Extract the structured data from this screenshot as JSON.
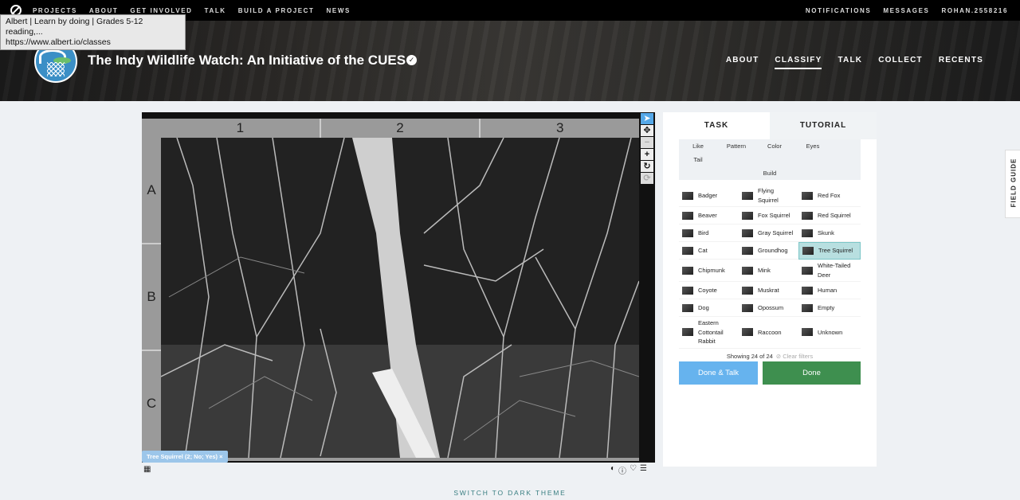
{
  "topnav": {
    "links": [
      "PROJECTS",
      "ABOUT",
      "GET INVOLVED",
      "TALK",
      "BUILD A PROJECT",
      "NEWS"
    ],
    "right": [
      "NOTIFICATIONS",
      "MESSAGES",
      "ROHAN.2558216"
    ]
  },
  "tooltip": {
    "line1": "Albert | Learn by doing | Grades 5-12 reading,...",
    "line2": "https://www.albert.io/classes"
  },
  "project": {
    "title": "The Indy Wildlife Watch: An Initiative of the CUES",
    "verified_icon": "check-icon",
    "nav": [
      "ABOUT",
      "CLASSIFY",
      "TALK",
      "COLLECT",
      "RECENTS"
    ],
    "active_nav": "CLASSIFY"
  },
  "viewer": {
    "cols": [
      "1",
      "2",
      "3"
    ],
    "rows": [
      "A",
      "B",
      "C"
    ],
    "tools": [
      "pointer-icon",
      "move-icon",
      "zoom-out-icon",
      "zoom-in-icon",
      "rotate-icon",
      "reset-icon"
    ],
    "tag": "Tree Squirrel (2; No; Yes)  ×"
  },
  "panel": {
    "tabs": {
      "task": "TASK",
      "tutorial": "TUTORIAL"
    },
    "filters": [
      "Like",
      "Pattern",
      "Color",
      "Eyes",
      "Tail",
      "Build"
    ],
    "species": [
      {
        "name": "Badger"
      },
      {
        "name": "Flying Squirrel"
      },
      {
        "name": "Red Fox"
      },
      {
        "name": "Beaver"
      },
      {
        "name": "Fox Squirrel"
      },
      {
        "name": "Red Squirrel"
      },
      {
        "name": "Bird"
      },
      {
        "name": "Gray Squirrel"
      },
      {
        "name": "Skunk"
      },
      {
        "name": "Cat"
      },
      {
        "name": "Groundhog"
      },
      {
        "name": "Tree Squirrel",
        "selected": true
      },
      {
        "name": "Chipmunk"
      },
      {
        "name": "Mink"
      },
      {
        "name": "White-Tailed Deer"
      },
      {
        "name": "Coyote"
      },
      {
        "name": "Muskrat"
      },
      {
        "name": "Human"
      },
      {
        "name": "Dog"
      },
      {
        "name": "Opossum"
      },
      {
        "name": "Empty"
      },
      {
        "name": "Eastern Cottontail Rabbit"
      },
      {
        "name": "Raccoon"
      },
      {
        "name": "Unknown"
      }
    ],
    "showing": "Showing 24 of 24",
    "clear_filters": "⊘ Clear filters",
    "done_talk": "Done & Talk",
    "done": "Done"
  },
  "field_guide": "FIELD GUIDE",
  "dark_theme": "SWITCH TO DARK THEME"
}
